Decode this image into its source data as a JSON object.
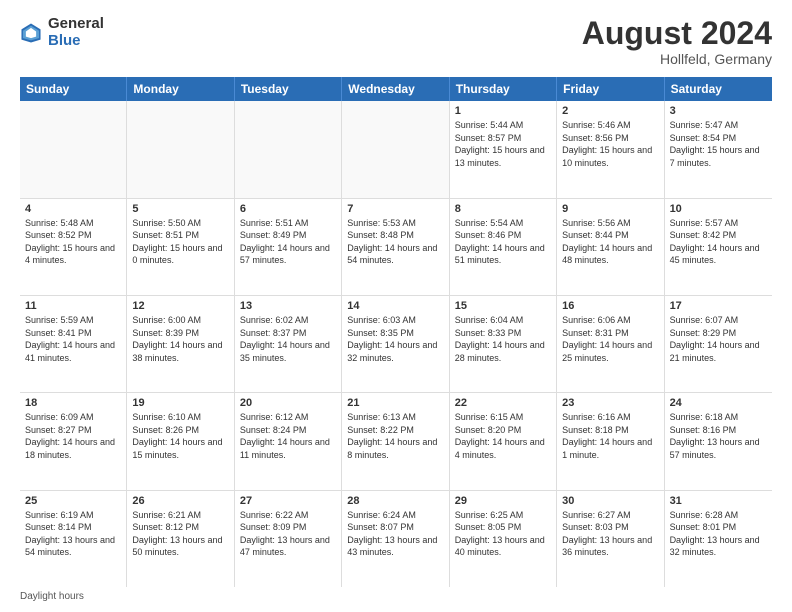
{
  "header": {
    "logo_general": "General",
    "logo_blue": "Blue",
    "month_title": "August 2024",
    "location": "Hollfeld, Germany"
  },
  "calendar": {
    "days_of_week": [
      "Sunday",
      "Monday",
      "Tuesday",
      "Wednesday",
      "Thursday",
      "Friday",
      "Saturday"
    ],
    "weeks": [
      [
        {
          "day": "",
          "info": ""
        },
        {
          "day": "",
          "info": ""
        },
        {
          "day": "",
          "info": ""
        },
        {
          "day": "",
          "info": ""
        },
        {
          "day": "1",
          "info": "Sunrise: 5:44 AM\nSunset: 8:57 PM\nDaylight: 15 hours\nand 13 minutes."
        },
        {
          "day": "2",
          "info": "Sunrise: 5:46 AM\nSunset: 8:56 PM\nDaylight: 15 hours\nand 10 minutes."
        },
        {
          "day": "3",
          "info": "Sunrise: 5:47 AM\nSunset: 8:54 PM\nDaylight: 15 hours\nand 7 minutes."
        }
      ],
      [
        {
          "day": "4",
          "info": "Sunrise: 5:48 AM\nSunset: 8:52 PM\nDaylight: 15 hours\nand 4 minutes."
        },
        {
          "day": "5",
          "info": "Sunrise: 5:50 AM\nSunset: 8:51 PM\nDaylight: 15 hours\nand 0 minutes."
        },
        {
          "day": "6",
          "info": "Sunrise: 5:51 AM\nSunset: 8:49 PM\nDaylight: 14 hours\nand 57 minutes."
        },
        {
          "day": "7",
          "info": "Sunrise: 5:53 AM\nSunset: 8:48 PM\nDaylight: 14 hours\nand 54 minutes."
        },
        {
          "day": "8",
          "info": "Sunrise: 5:54 AM\nSunset: 8:46 PM\nDaylight: 14 hours\nand 51 minutes."
        },
        {
          "day": "9",
          "info": "Sunrise: 5:56 AM\nSunset: 8:44 PM\nDaylight: 14 hours\nand 48 minutes."
        },
        {
          "day": "10",
          "info": "Sunrise: 5:57 AM\nSunset: 8:42 PM\nDaylight: 14 hours\nand 45 minutes."
        }
      ],
      [
        {
          "day": "11",
          "info": "Sunrise: 5:59 AM\nSunset: 8:41 PM\nDaylight: 14 hours\nand 41 minutes."
        },
        {
          "day": "12",
          "info": "Sunrise: 6:00 AM\nSunset: 8:39 PM\nDaylight: 14 hours\nand 38 minutes."
        },
        {
          "day": "13",
          "info": "Sunrise: 6:02 AM\nSunset: 8:37 PM\nDaylight: 14 hours\nand 35 minutes."
        },
        {
          "day": "14",
          "info": "Sunrise: 6:03 AM\nSunset: 8:35 PM\nDaylight: 14 hours\nand 32 minutes."
        },
        {
          "day": "15",
          "info": "Sunrise: 6:04 AM\nSunset: 8:33 PM\nDaylight: 14 hours\nand 28 minutes."
        },
        {
          "day": "16",
          "info": "Sunrise: 6:06 AM\nSunset: 8:31 PM\nDaylight: 14 hours\nand 25 minutes."
        },
        {
          "day": "17",
          "info": "Sunrise: 6:07 AM\nSunset: 8:29 PM\nDaylight: 14 hours\nand 21 minutes."
        }
      ],
      [
        {
          "day": "18",
          "info": "Sunrise: 6:09 AM\nSunset: 8:27 PM\nDaylight: 14 hours\nand 18 minutes."
        },
        {
          "day": "19",
          "info": "Sunrise: 6:10 AM\nSunset: 8:26 PM\nDaylight: 14 hours\nand 15 minutes."
        },
        {
          "day": "20",
          "info": "Sunrise: 6:12 AM\nSunset: 8:24 PM\nDaylight: 14 hours\nand 11 minutes."
        },
        {
          "day": "21",
          "info": "Sunrise: 6:13 AM\nSunset: 8:22 PM\nDaylight: 14 hours\nand 8 minutes."
        },
        {
          "day": "22",
          "info": "Sunrise: 6:15 AM\nSunset: 8:20 PM\nDaylight: 14 hours\nand 4 minutes."
        },
        {
          "day": "23",
          "info": "Sunrise: 6:16 AM\nSunset: 8:18 PM\nDaylight: 14 hours\nand 1 minute."
        },
        {
          "day": "24",
          "info": "Sunrise: 6:18 AM\nSunset: 8:16 PM\nDaylight: 13 hours\nand 57 minutes."
        }
      ],
      [
        {
          "day": "25",
          "info": "Sunrise: 6:19 AM\nSunset: 8:14 PM\nDaylight: 13 hours\nand 54 minutes."
        },
        {
          "day": "26",
          "info": "Sunrise: 6:21 AM\nSunset: 8:12 PM\nDaylight: 13 hours\nand 50 minutes."
        },
        {
          "day": "27",
          "info": "Sunrise: 6:22 AM\nSunset: 8:09 PM\nDaylight: 13 hours\nand 47 minutes."
        },
        {
          "day": "28",
          "info": "Sunrise: 6:24 AM\nSunset: 8:07 PM\nDaylight: 13 hours\nand 43 minutes."
        },
        {
          "day": "29",
          "info": "Sunrise: 6:25 AM\nSunset: 8:05 PM\nDaylight: 13 hours\nand 40 minutes."
        },
        {
          "day": "30",
          "info": "Sunrise: 6:27 AM\nSunset: 8:03 PM\nDaylight: 13 hours\nand 36 minutes."
        },
        {
          "day": "31",
          "info": "Sunrise: 6:28 AM\nSunset: 8:01 PM\nDaylight: 13 hours\nand 32 minutes."
        }
      ]
    ]
  },
  "footer": {
    "note": "Daylight hours"
  }
}
